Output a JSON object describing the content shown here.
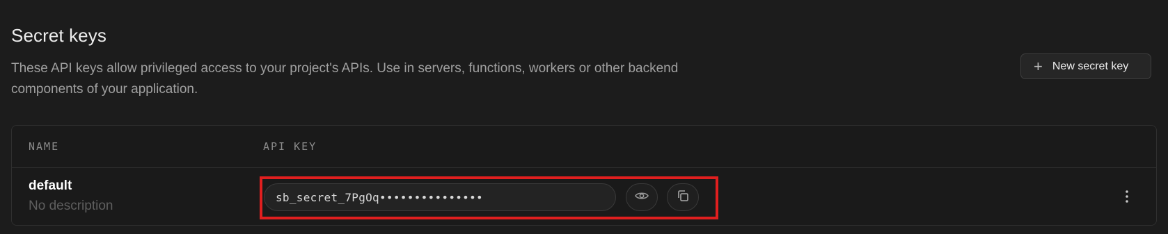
{
  "section": {
    "title": "Secret keys",
    "description": "These API keys allow privileged access to your project's APIs. Use in servers, functions, workers or other backend components of your application.",
    "new_key_button": {
      "label": "New secret key",
      "icon": "plus-icon"
    }
  },
  "table": {
    "columns": [
      "NAME",
      "API KEY"
    ],
    "rows": [
      {
        "name": "default",
        "description": "No description",
        "api_key_masked": "sb_secret_7PgOq•••••••••••••••",
        "actions": {
          "reveal_icon": "eye-icon",
          "copy_icon": "copy-icon",
          "more_icon": "more-vertical-icon"
        }
      }
    ]
  },
  "colors": {
    "background": "#1c1c1c",
    "highlight": "#e01f1f",
    "muted_text": "#a0a0a0",
    "border": "#2f2f2f"
  }
}
